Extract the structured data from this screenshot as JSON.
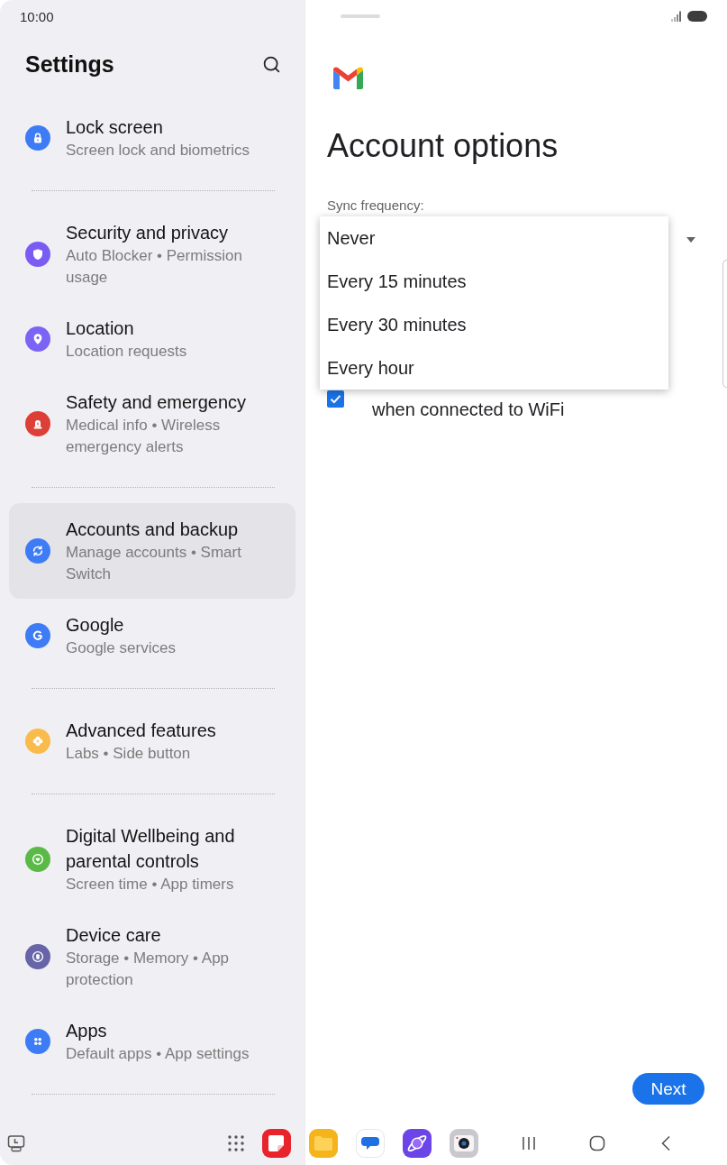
{
  "status_bar": {
    "time": "10:00"
  },
  "settings": {
    "title": "Settings",
    "groups": [
      {
        "items": [
          {
            "title": "Lock screen",
            "subtitle": "Screen lock and biometrics",
            "color": "#3e7cf6",
            "selected": false
          }
        ]
      },
      {
        "items": [
          {
            "title": "Security and privacy",
            "subtitle": "Auto Blocker • Permission usage",
            "color": "#7b5cf2",
            "selected": false
          },
          {
            "title": "Location",
            "subtitle": "Location requests",
            "color": "#7a63f5",
            "selected": false
          },
          {
            "title": "Safety and emergency",
            "subtitle": "Medical info • Wireless emergency alerts",
            "color": "#dd3f37",
            "selected": false
          }
        ]
      },
      {
        "items": [
          {
            "title": "Accounts and backup",
            "subtitle": "Manage accounts • Smart Switch",
            "color": "#3e7cf6",
            "selected": true
          },
          {
            "title": "Google",
            "subtitle": "Google services",
            "color": "#3e7cf6",
            "selected": false
          }
        ]
      },
      {
        "items": [
          {
            "title": "Advanced features",
            "subtitle": "Labs • Side button",
            "color": "#f8bb4c",
            "selected": false
          }
        ]
      },
      {
        "items": [
          {
            "title": "Digital Wellbeing and parental controls",
            "subtitle": "Screen time • App timers",
            "color": "#5bba47",
            "selected": false
          },
          {
            "title": "Device care",
            "subtitle": "Storage • Memory • App protection",
            "color": "#6864a8",
            "selected": false
          },
          {
            "title": "Apps",
            "subtitle": "Default apps • App settings",
            "color": "#3e7cf6",
            "selected": false
          }
        ]
      }
    ]
  },
  "account_options": {
    "title": "Account options",
    "sync_frequency": {
      "label": "Sync frequency:",
      "expanded": true,
      "options": [
        "Never",
        "Every 15 minutes",
        "Every 30 minutes",
        "Every hour"
      ]
    },
    "download_attachments": {
      "label": "when connected to WiFi",
      "checked": true
    },
    "next_button": {
      "label": "Next"
    }
  }
}
